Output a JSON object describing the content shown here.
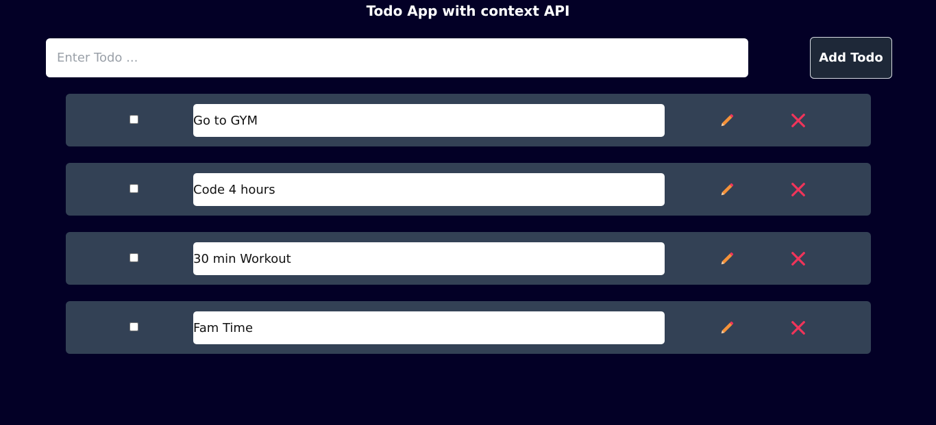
{
  "header": {
    "title": "Todo App with context API"
  },
  "form": {
    "placeholder": "Enter Todo ...",
    "value": "",
    "add_label": "Add Todo"
  },
  "todos": [
    {
      "text": "Go to GYM",
      "completed": false,
      "edit_icon": "pencil-icon",
      "delete_icon": "close-icon"
    },
    {
      "text": "Code 4 hours",
      "completed": false,
      "edit_icon": "pencil-icon",
      "delete_icon": "close-icon"
    },
    {
      "text": "30 min Workout",
      "completed": false,
      "edit_icon": "pencil-icon",
      "delete_icon": "close-icon"
    },
    {
      "text": "Fam Time",
      "completed": false,
      "edit_icon": "pencil-icon",
      "delete_icon": "close-icon"
    }
  ],
  "colors": {
    "background": "#030026",
    "row": "#334155",
    "button": "#1e2838",
    "edit_icon": "#f5923a",
    "delete_icon": "#f0345a"
  }
}
